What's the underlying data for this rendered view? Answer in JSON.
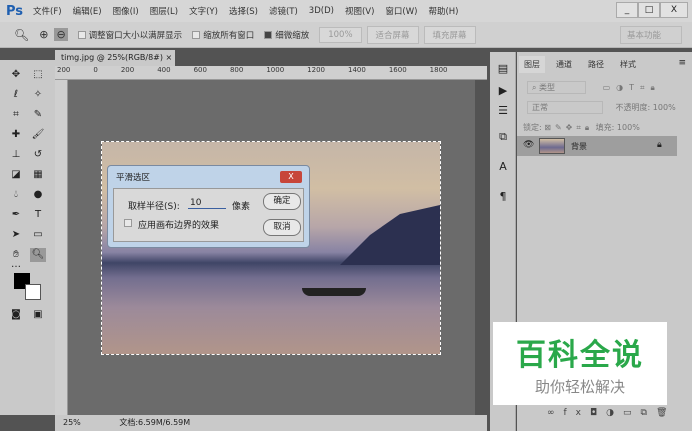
{
  "app": {
    "logo": "Ps",
    "menu": [
      "文件(F)",
      "编辑(E)",
      "图像(I)",
      "图层(L)",
      "文字(Y)",
      "选择(S)",
      "滤镜(T)",
      "3D(D)",
      "视图(V)",
      "窗口(W)",
      "帮助(H)"
    ],
    "window_buttons": [
      "_",
      "□",
      "X"
    ]
  },
  "options": {
    "resize_windows": "调整窗口大小以满屏显示",
    "zoom_all": "缩放所有窗口",
    "scrubby_zoom": "细微缩放",
    "zoom_value": "100%",
    "fit_screen": "适合屏幕",
    "fill_screen": "填充屏幕",
    "workspace": "基本功能"
  },
  "document": {
    "tab": "timg.jpg @ 25%(RGB/8#)",
    "tab_close": "×",
    "ruler_top": [
      "200",
      "0",
      "200",
      "400",
      "600",
      "800",
      "1000",
      "1200",
      "1400",
      "1600",
      "1800"
    ],
    "zoom": "25%",
    "doc_size": "文档:6.59M/6.59M"
  },
  "dialog": {
    "title": "平滑选区",
    "close": "X",
    "radius_label": "取样半径(S):",
    "radius_value": "10",
    "unit": "像素",
    "apply_canvas": "应用画布边界的效果",
    "ok": "确定",
    "cancel": "取消"
  },
  "layers": {
    "tabs": [
      "图层",
      "通道",
      "路径",
      "样式"
    ],
    "filter": "类型",
    "blend": "正常",
    "opacity_label": "不透明度:",
    "opacity": "100%",
    "lock_label": "锁定:",
    "fill_label": "填充:",
    "fill": "100%",
    "layer_name": "背景"
  },
  "watermark": {
    "title": "百科全说",
    "subtitle": "助你轻松解决"
  }
}
